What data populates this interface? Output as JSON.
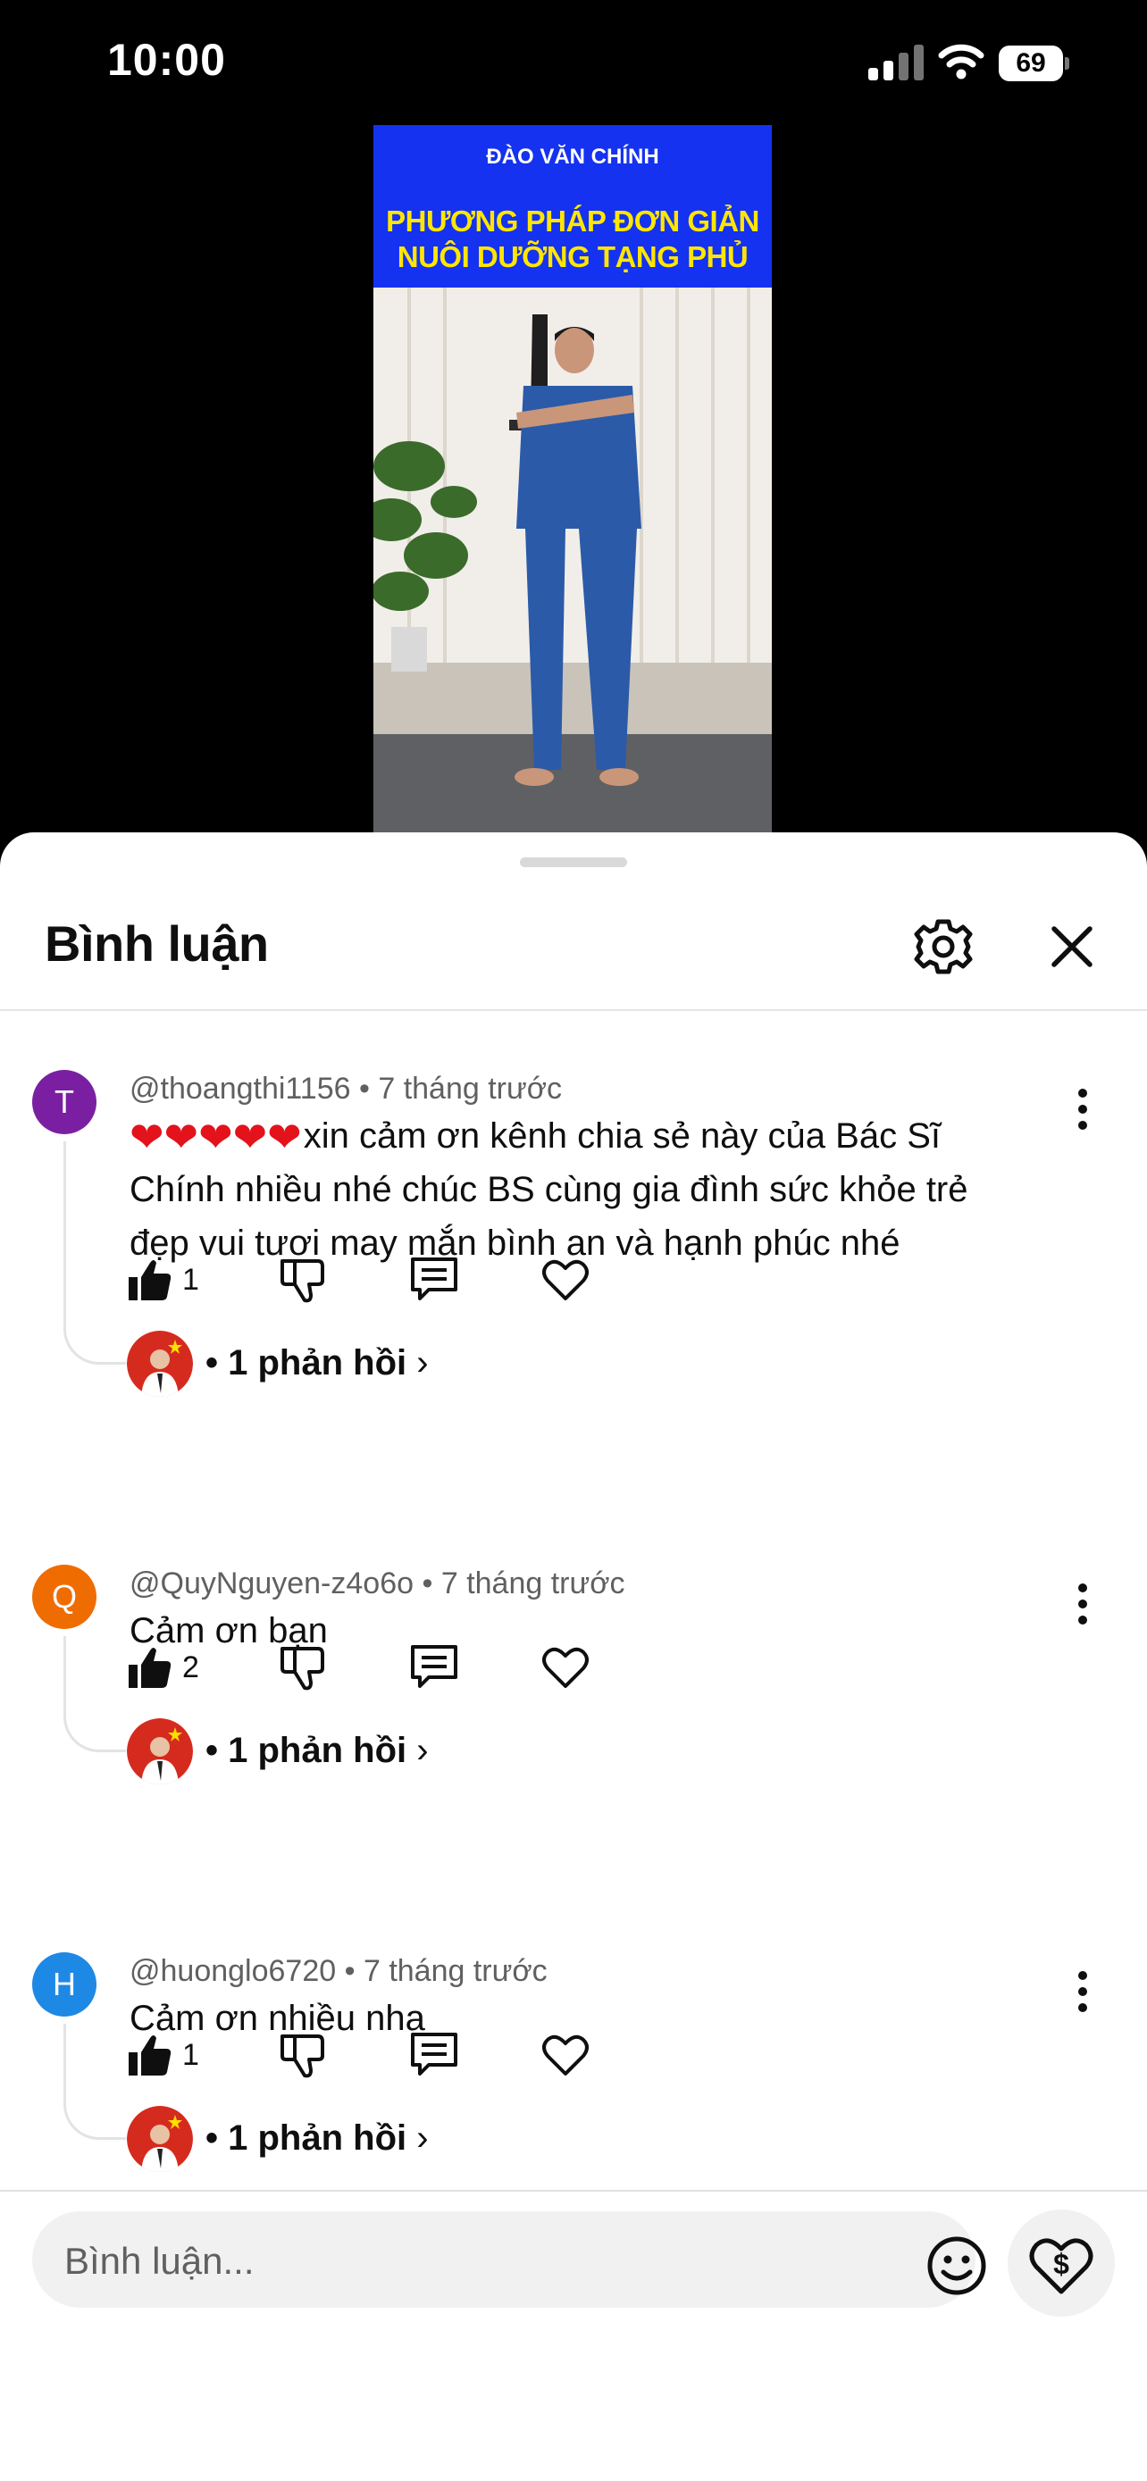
{
  "status_bar": {
    "time": "10:00",
    "battery": "69"
  },
  "video": {
    "author": "ĐÀO VĂN CHÍNH",
    "title_line1": "PHƯƠNG PHÁP ĐƠN GIẢN",
    "title_line2": "NUÔI DƯỠNG TẠNG PHỦ"
  },
  "sheet": {
    "title": "Bình luận"
  },
  "comments": [
    {
      "avatar_letter": "T",
      "avatar_color": "#7b1fa2",
      "handle": "@thoangthi1156",
      "time": "• 7 tháng trước",
      "text_line1": "xin cảm ơn kênh chia sẻ này của Bác Sĩ",
      "text_line2": "Chính nhiều nhé chúc BS cùng gia đình sức khỏe trẻ",
      "text_line3": "đẹp vui tươi may mắn bình an và hạnh phúc nhé",
      "hearts": "❤❤❤❤❤",
      "likes": "1",
      "replies": "• 1 phản hồi"
    },
    {
      "avatar_letter": "Q",
      "avatar_color": "#ef6c00",
      "handle": "@QuyNguyen-z4o6o",
      "time": "• 7 tháng trước",
      "text_line1": "Cảm ơn bạn",
      "likes": "2",
      "replies": "• 1 phản hồi"
    },
    {
      "avatar_letter": "H",
      "avatar_color": "#1e88e5",
      "handle": "@huonglo6720",
      "time": "• 7 tháng trước",
      "text_line1": "Cảm ơn nhiều nha",
      "likes": "1",
      "replies": "• 1 phản hồi"
    }
  ],
  "composer": {
    "placeholder": "Bình luận..."
  },
  "icons": {
    "settings": "gear-icon",
    "close": "close-icon",
    "more": "more-vertical-icon",
    "like": "thumbs-up-icon",
    "dislike": "thumbs-down-icon",
    "reply": "comment-icon",
    "heart": "heart-icon",
    "emoji": "emoji-icon",
    "thanks": "super-thanks-icon"
  }
}
